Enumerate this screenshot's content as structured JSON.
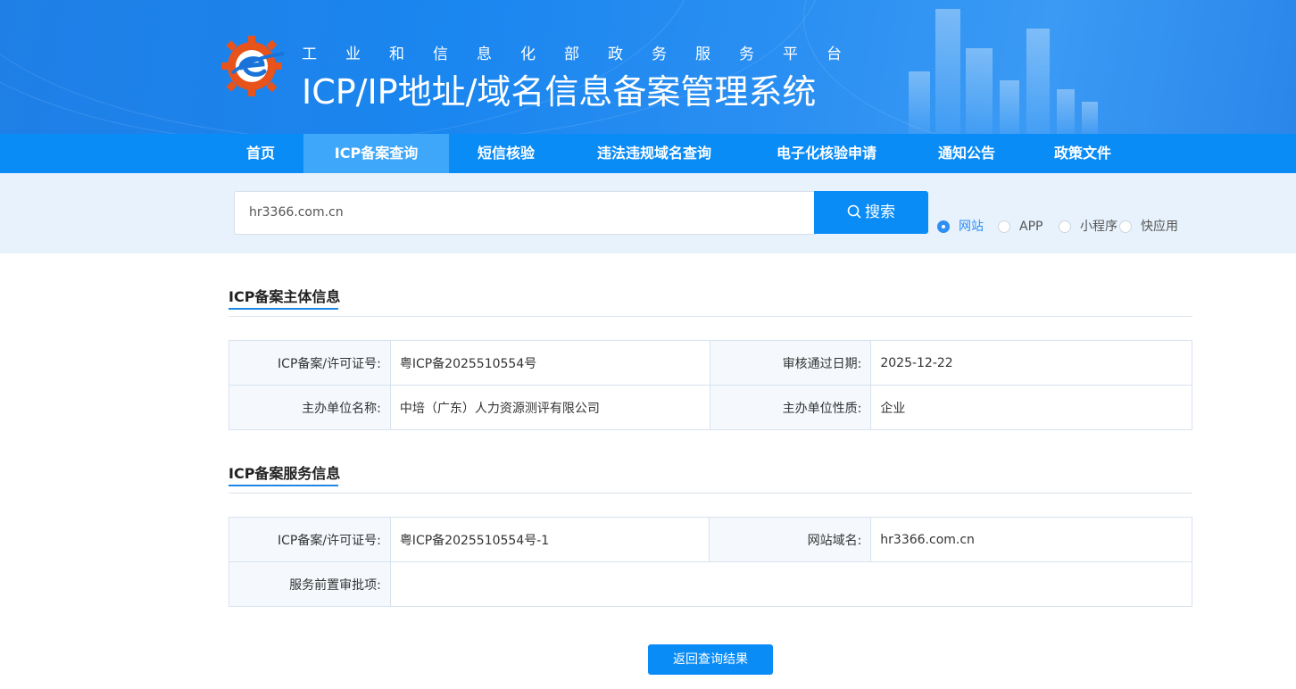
{
  "header": {
    "subtitle": "工业和信息化部政务服务平台",
    "title": "ICP/IP地址/域名信息备案管理系统"
  },
  "nav": {
    "items": [
      {
        "label": "首页"
      },
      {
        "label": "ICP备案查询",
        "active": true
      },
      {
        "label": "短信核验"
      },
      {
        "label": "违法违规域名查询"
      },
      {
        "label": "电子化核验申请"
      },
      {
        "label": "通知公告"
      },
      {
        "label": "政策文件"
      }
    ]
  },
  "search": {
    "value": "hr3366.com.cn",
    "button_label": "搜索",
    "types": [
      {
        "label": "网站",
        "checked": true
      },
      {
        "label": "APP",
        "checked": false
      },
      {
        "label": "小程序",
        "checked": false
      },
      {
        "label": "快应用",
        "checked": false
      }
    ]
  },
  "subject_info": {
    "title": "ICP备案主体信息",
    "rows": [
      {
        "k1": "ICP备案/许可证号:",
        "v1": "粤ICP备2025510554号",
        "k2": "审核通过日期:",
        "v2": "2025-12-22"
      },
      {
        "k1": "主办单位名称:",
        "v1": "中培（广东）人力资源测评有限公司",
        "k2": "主办单位性质:",
        "v2": "企业"
      }
    ]
  },
  "service_info": {
    "title": "ICP备案服务信息",
    "rows": [
      {
        "k1": "ICP备案/许可证号:",
        "v1": "粤ICP备2025510554号-1",
        "k2": "网站域名:",
        "v2": "hr3366.com.cn"
      },
      {
        "k1": "服务前置审批项:",
        "v1": ""
      }
    ]
  },
  "back_button_label": "返回查询结果",
  "colors": {
    "primary": "#0a8cf7",
    "nav_active": "#3ea7f9",
    "search_band": "#e7f2fc"
  }
}
